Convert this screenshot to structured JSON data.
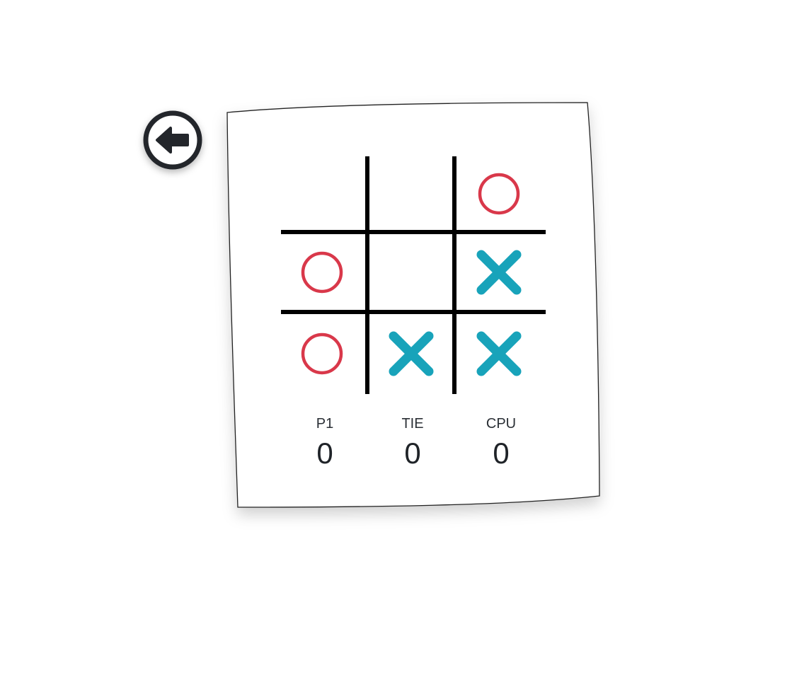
{
  "board": {
    "cells": [
      "",
      "",
      "O",
      "O",
      "",
      "X",
      "O",
      "X",
      "X"
    ]
  },
  "scores": [
    {
      "label": "P1",
      "value": "0"
    },
    {
      "label": "TIE",
      "value": "0"
    },
    {
      "label": "CPU",
      "value": "0"
    }
  ],
  "colors": {
    "o_mark": "#d9384a",
    "x_mark": "#18a3ba",
    "grid": "#000000",
    "back_icon": "#23262b"
  },
  "icons": {
    "back": "arrow-left-circle-icon"
  }
}
